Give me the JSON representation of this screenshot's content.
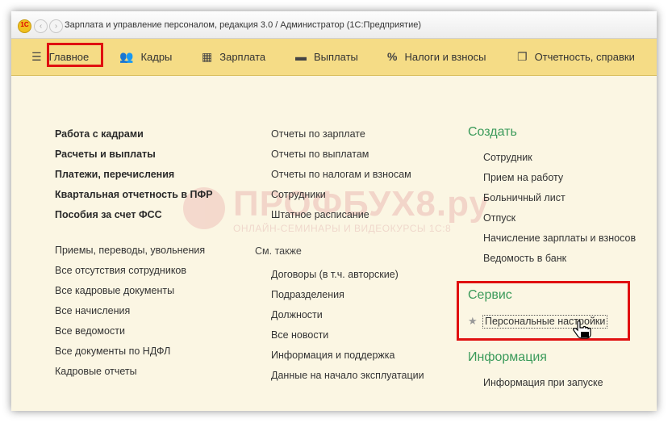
{
  "window": {
    "title": "Зарплата и управление персоналом, редакция 3.0 / Администратор  (1С:Предприятие)",
    "logo_text": "1С"
  },
  "sections": [
    {
      "label": "Главное",
      "icon": "menu-lines-icon"
    },
    {
      "label": "Кадры",
      "icon": "people-icon"
    },
    {
      "label": "Зарплата",
      "icon": "calculator-icon"
    },
    {
      "label": "Выплаты",
      "icon": "wallet-icon"
    },
    {
      "label": "Налоги и взносы",
      "icon": "percent-icon"
    },
    {
      "label": "Отчетность, справки",
      "icon": "documents-icon"
    }
  ],
  "col1": {
    "bold": [
      "Работа с кадрами",
      "Расчеты и выплаты",
      "Платежи, перечисления",
      "Квартальная отчетность в ПФР",
      "Пособия за счет ФСС"
    ],
    "regular": [
      "Приемы, переводы, увольнения",
      "Все отсутствия сотрудников",
      "Все кадровые документы",
      "Все начисления",
      "Все ведомости",
      "Все документы по НДФЛ",
      "Кадровые отчеты"
    ]
  },
  "col2": {
    "top": [
      "Отчеты по зарплате",
      "Отчеты по выплатам",
      "Отчеты по налогам и взносам",
      "Сотрудники",
      "Штатное расписание"
    ],
    "see_also_label": "См. также",
    "see_also": [
      "Договоры (в т.ч. авторские)",
      "Подразделения",
      "Должности",
      "Все новости",
      "Информация и поддержка",
      "Данные на начало эксплуатации"
    ]
  },
  "col3": {
    "create_title": "Создать",
    "create": [
      "Сотрудник",
      "Прием на работу",
      "Больничный лист",
      "Отпуск",
      "Начисление зарплаты и взносов",
      "Ведомость в банк"
    ],
    "service_title": "Сервис",
    "service_item": "Персональные настройки",
    "info_title": "Информация",
    "info_item": "Информация при запуске"
  },
  "watermark": {
    "big": "ПРОФБУХ8.ру",
    "small": "ОНЛАЙН-СЕМИНАРЫ И ВИДЕОКУРСЫ 1С:8"
  },
  "colors": {
    "section_bar": "#f5dc86",
    "content_bg": "#fbf6e3",
    "group_title": "#3a9a5a",
    "highlight": "#e01010"
  }
}
